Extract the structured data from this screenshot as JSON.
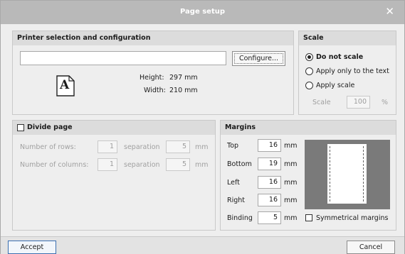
{
  "window": {
    "title": "Page setup",
    "close_glyph": "✕"
  },
  "printer": {
    "header": "Printer selection and configuration",
    "printer_value": "",
    "configure_label": "Configure...",
    "paper_icon_letter": "A",
    "height_label": "Height:",
    "height_value": "297 mm",
    "width_label": "Width:",
    "width_value": "210 mm"
  },
  "scale": {
    "header": "Scale",
    "options": [
      "Do not scale",
      "Apply only to the text",
      "Apply scale"
    ],
    "selected": "Do not scale",
    "scale_label": "Scale",
    "scale_value": "100",
    "scale_unit": "%"
  },
  "divide": {
    "header": "Divide page",
    "checked": false,
    "rows_label": "Number of rows:",
    "rows_value": "1",
    "rows_sep_label": "separation",
    "rows_sep_value": "5",
    "rows_unit": "mm",
    "cols_label": "Number of columns:",
    "cols_value": "1",
    "cols_sep_label": "separation",
    "cols_sep_value": "5",
    "cols_unit": "mm"
  },
  "margins": {
    "header": "Margins",
    "unit": "mm",
    "rows": [
      {
        "label": "Top",
        "value": "16"
      },
      {
        "label": "Bottom",
        "value": "19"
      },
      {
        "label": "Left",
        "value": "16"
      },
      {
        "label": "Right",
        "value": "16"
      },
      {
        "label": "Binding",
        "value": "5"
      }
    ],
    "symmetrical_label": "Symmetrical margins",
    "symmetrical_checked": false
  },
  "footer": {
    "accept_label": "Accept",
    "cancel_label": "Cancel"
  }
}
